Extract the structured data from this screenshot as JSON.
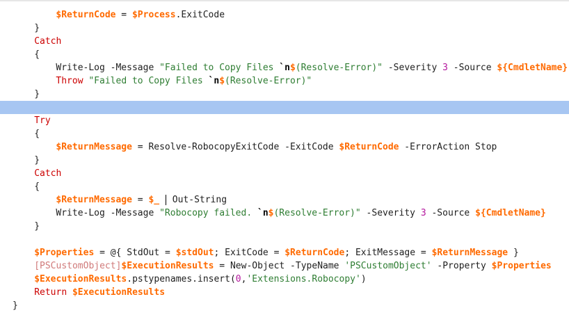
{
  "editor": {
    "colors": {
      "variable": "#ff6a00",
      "keyword": "#cc0000",
      "string": "#2e7d32",
      "number": "#b5179e",
      "type": "#d07a7a",
      "highlight": "#a7c6f2"
    },
    "lines": [
      {
        "indent": 8,
        "tokens": [
          [
            "v",
            "$ReturnCode"
          ],
          [
            "t",
            " = "
          ],
          [
            "v",
            "$Process"
          ],
          [
            "t",
            ".ExitCode"
          ]
        ]
      },
      {
        "indent": 4,
        "tokens": [
          [
            "t",
            "}"
          ]
        ]
      },
      {
        "indent": 4,
        "tokens": [
          [
            "k",
            "Catch"
          ]
        ]
      },
      {
        "indent": 4,
        "tokens": [
          [
            "t",
            "{"
          ]
        ]
      },
      {
        "indent": 8,
        "tokens": [
          [
            "t",
            "Write-Log -Message "
          ],
          [
            "s",
            "\"Failed to Copy Files "
          ],
          [
            "e",
            "`n"
          ],
          [
            "v",
            "$"
          ],
          [
            "s",
            "(Resolve-Error)\""
          ],
          [
            "t",
            " -Severity "
          ],
          [
            "n",
            "3"
          ],
          [
            "t",
            " -Source "
          ],
          [
            "v",
            "${CmdletName}"
          ]
        ]
      },
      {
        "indent": 8,
        "tokens": [
          [
            "k",
            "Throw"
          ],
          [
            "t",
            " "
          ],
          [
            "s",
            "\"Failed to Copy Files "
          ],
          [
            "e",
            "`n"
          ],
          [
            "v",
            "$"
          ],
          [
            "s",
            "(Resolve-Error)\""
          ]
        ]
      },
      {
        "indent": 4,
        "tokens": [
          [
            "t",
            "}"
          ]
        ]
      },
      {
        "indent": 0,
        "highlight": true,
        "tokens": []
      },
      {
        "indent": 4,
        "tokens": [
          [
            "k",
            "Try"
          ]
        ]
      },
      {
        "indent": 4,
        "tokens": [
          [
            "t",
            "{"
          ]
        ]
      },
      {
        "indent": 8,
        "tokens": [
          [
            "v",
            "$ReturnMessage"
          ],
          [
            "t",
            " = Resolve-RobocopyExitCode -ExitCode "
          ],
          [
            "v",
            "$ReturnCode"
          ],
          [
            "t",
            " -ErrorAction Stop"
          ]
        ]
      },
      {
        "indent": 4,
        "tokens": [
          [
            "t",
            "}"
          ]
        ]
      },
      {
        "indent": 4,
        "tokens": [
          [
            "k",
            "Catch"
          ]
        ]
      },
      {
        "indent": 4,
        "tokens": [
          [
            "t",
            "{"
          ]
        ]
      },
      {
        "indent": 8,
        "tokens": [
          [
            "v",
            "$ReturnMessage"
          ],
          [
            "t",
            " = "
          ],
          [
            "v",
            "$_"
          ],
          [
            "t",
            " "
          ],
          [
            "c",
            ""
          ],
          [
            "t",
            " Out-String"
          ]
        ]
      },
      {
        "indent": 8,
        "tokens": [
          [
            "t",
            "Write-Log -Message "
          ],
          [
            "s",
            "\"Robocopy failed. "
          ],
          [
            "e",
            "`n"
          ],
          [
            "v",
            "$"
          ],
          [
            "s",
            "(Resolve-Error)\""
          ],
          [
            "t",
            " -Severity "
          ],
          [
            "n",
            "3"
          ],
          [
            "t",
            " -Source "
          ],
          [
            "v",
            "${CmdletName}"
          ]
        ]
      },
      {
        "indent": 4,
        "tokens": [
          [
            "t",
            "}"
          ]
        ]
      },
      {
        "indent": 0,
        "tokens": []
      },
      {
        "indent": 4,
        "tokens": [
          [
            "v",
            "$Properties"
          ],
          [
            "t",
            " = @{ StdOut = "
          ],
          [
            "v",
            "$stdOut"
          ],
          [
            "t",
            "; ExitCode = "
          ],
          [
            "v",
            "$ReturnCode"
          ],
          [
            "t",
            "; ExitMessage = "
          ],
          [
            "v",
            "$ReturnMessage"
          ],
          [
            "t",
            " }"
          ]
        ]
      },
      {
        "indent": 4,
        "tokens": [
          [
            "y",
            "[PSCustomObject]"
          ],
          [
            "v",
            "$ExecutionResults"
          ],
          [
            "t",
            " = New-Object -TypeName "
          ],
          [
            "s",
            "'PSCustomObject'"
          ],
          [
            "t",
            " -Property "
          ],
          [
            "v",
            "$Properties"
          ]
        ]
      },
      {
        "indent": 4,
        "tokens": [
          [
            "v",
            "$ExecutionResults"
          ],
          [
            "t",
            ".pstypenames.insert("
          ],
          [
            "n",
            "0"
          ],
          [
            "t",
            ","
          ],
          [
            "s",
            "'Extensions.Robocopy'"
          ],
          [
            "t",
            ")"
          ]
        ]
      },
      {
        "indent": 4,
        "tokens": [
          [
            "k",
            "Return"
          ],
          [
            "t",
            " "
          ],
          [
            "v",
            "$ExecutionResults"
          ]
        ]
      },
      {
        "indent": 0,
        "tokens": [
          [
            "t",
            "}"
          ]
        ]
      }
    ]
  }
}
